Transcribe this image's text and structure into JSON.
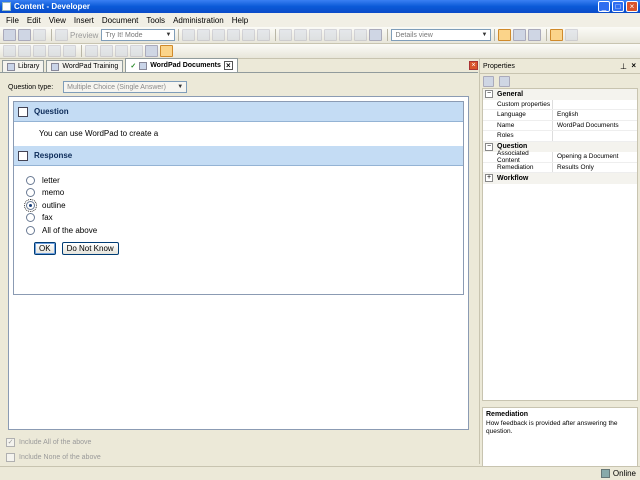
{
  "window": {
    "title": "Content - Developer"
  },
  "menu": [
    "File",
    "Edit",
    "View",
    "Insert",
    "Document",
    "Tools",
    "Administration",
    "Help"
  ],
  "toolbar": {
    "preview_label": "Preview",
    "mode_value": "Try It! Mode",
    "view_value": "Details view"
  },
  "tabs": [
    "Library",
    "WordPad Training",
    "WordPad Documents"
  ],
  "editor": {
    "question_type_label": "Question type:",
    "question_type_value": "Multiple Choice (Single Answer)",
    "question_header": "Question",
    "question_text": "You can use WordPad to create a",
    "response_header": "Response",
    "options": [
      "letter",
      "memo",
      "outline",
      "fax",
      "All of the above"
    ],
    "selected_option": "outline",
    "ok_label": "OK",
    "do_not_know_label": "Do Not Know",
    "include_all_label": "Include All of the above",
    "include_none_label": "Include None of the above"
  },
  "properties": {
    "title": "Properties",
    "categories": [
      {
        "name": "General",
        "expanded": true,
        "rows": [
          {
            "name": "Custom properties",
            "value": ""
          },
          {
            "name": "Language",
            "value": "English"
          },
          {
            "name": "Name",
            "value": "WordPad Documents"
          },
          {
            "name": "Roles",
            "value": ""
          }
        ]
      },
      {
        "name": "Question",
        "expanded": true,
        "rows": [
          {
            "name": "Associated Content",
            "value": "Opening a Document"
          },
          {
            "name": "Remediation",
            "value": "Results Only"
          }
        ]
      },
      {
        "name": "Workflow",
        "expanded": false,
        "rows": []
      }
    ],
    "description_title": "Remediation",
    "description_text": "How feedback is provided after answering the question."
  },
  "status": {
    "connection": "Online"
  }
}
